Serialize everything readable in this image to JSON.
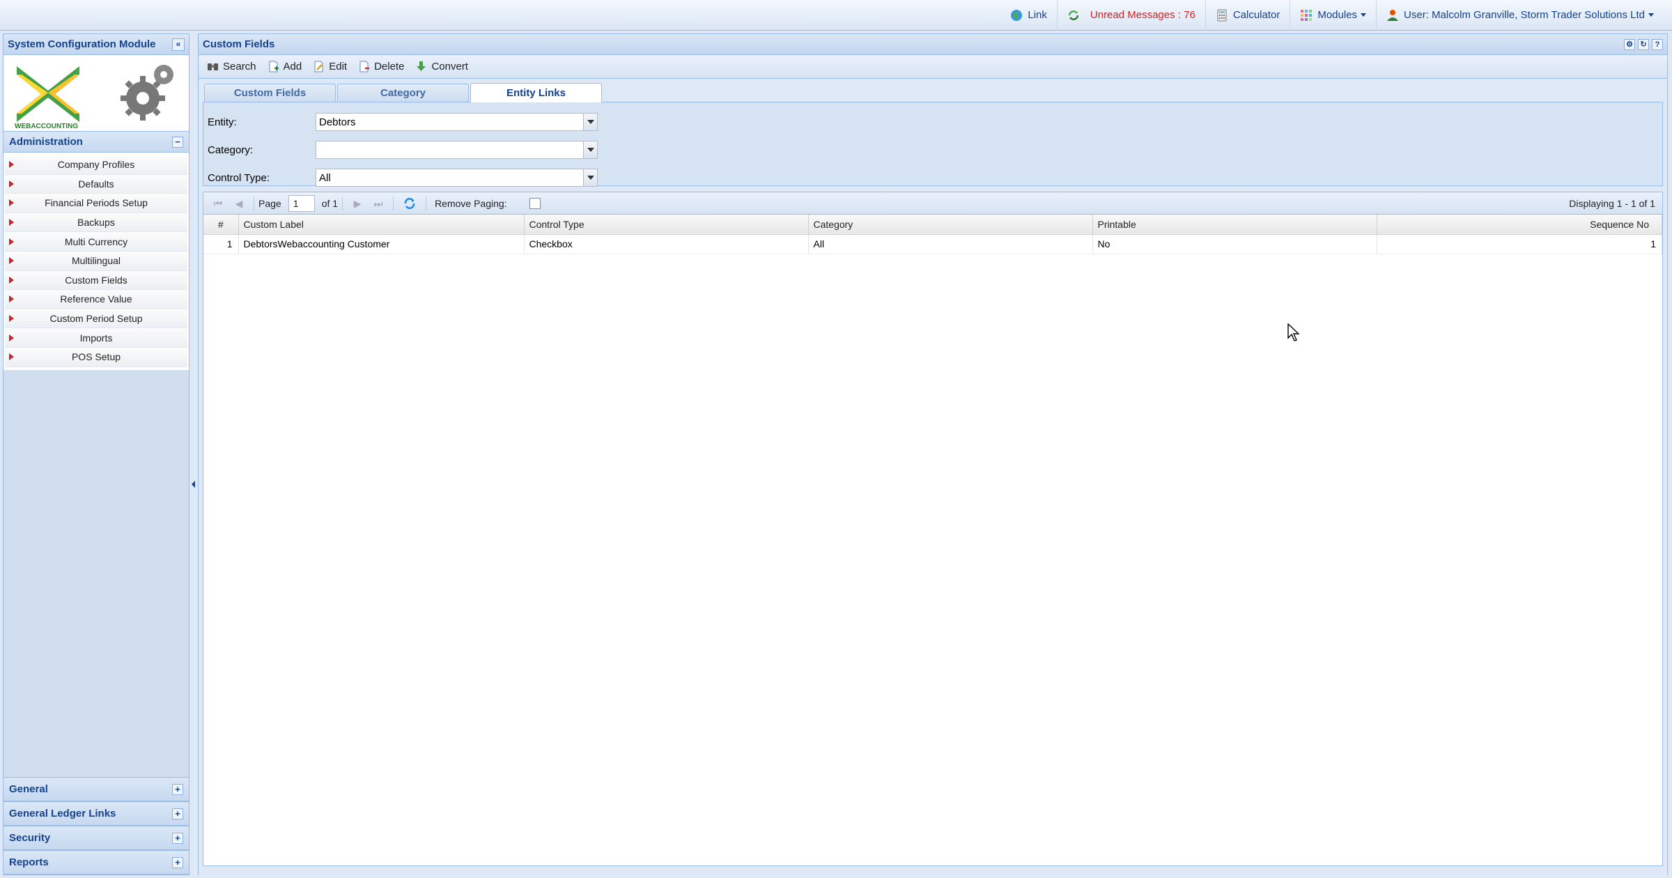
{
  "topbar": {
    "link": "Link",
    "unread": "Unread Messages : 76",
    "calculator": "Calculator",
    "modules": "Modules",
    "user": "User: Malcolm Granville, Storm Trader Solutions Ltd"
  },
  "left": {
    "title": "System Configuration Module",
    "logo_text": "WEBACCOUNTING",
    "admin_header": "Administration",
    "admin_items": [
      "Company Profiles",
      "Defaults",
      "Financial Periods Setup",
      "Backups",
      "Multi Currency",
      "Multilingual",
      "Custom Fields",
      "Reference Value",
      "Custom Period Setup",
      "Imports",
      "POS Setup"
    ],
    "sections": [
      "General",
      "General Ledger Links",
      "Security",
      "Reports"
    ]
  },
  "main": {
    "title": "Custom Fields",
    "toolbar": {
      "search": "Search",
      "add": "Add",
      "edit": "Edit",
      "delete": "Delete",
      "convert": "Convert"
    },
    "tabs": [
      "Custom Fields",
      "Category",
      "Entity Links"
    ],
    "form": {
      "entity_label": "Entity:",
      "entity_value": "Debtors",
      "category_label": "Category:",
      "category_value": "",
      "control_label": "Control Type:",
      "control_value": "All"
    },
    "paging": {
      "page_label": "Page",
      "page_value": "1",
      "of_label": "of 1",
      "remove_paging": "Remove Paging:",
      "displaying": "Displaying 1 - 1 of 1"
    },
    "grid": {
      "columns": [
        "#",
        "Custom Label",
        "Control Type",
        "Category",
        "Printable",
        "Sequence No"
      ],
      "rows": [
        {
          "n": "1",
          "label": "DebtorsWebaccounting Customer",
          "control": "Checkbox",
          "category": "All",
          "printable": "No",
          "seq": "1"
        }
      ]
    }
  },
  "colors": {
    "accent": "#15428b",
    "unread": "#d42020",
    "panel_bg": "#dfe8f6",
    "menu_arrow": "#c1272d"
  }
}
